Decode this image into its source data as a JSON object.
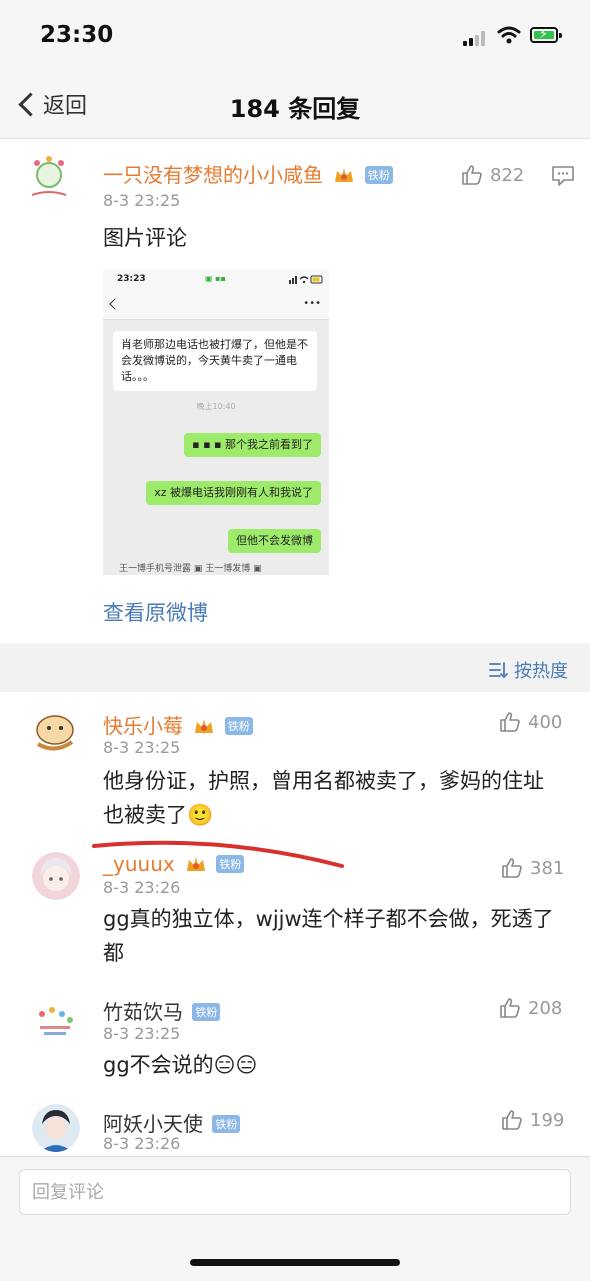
{
  "status_bar": {
    "time": "23:30"
  },
  "nav": {
    "back_label": "返回",
    "title": "184 条回复"
  },
  "main_comment": {
    "username": "一只没有梦想的小小咸鱼",
    "badge": "铁粉",
    "time": "8-3 23:25",
    "likes": "822",
    "text": "图片评论",
    "view_original": "查看原微博",
    "screenshot": {
      "time": "23:23",
      "message": "肖老师那边电话也被打爆了，但他是不会发微博说的，今天黄牛卖了一通电话。。。",
      "timestamp": "晚上10:40",
      "sent": [
        "▪ ▪ ▪ 那个我之前看到了",
        "xz 被爆电话我刚刚有人和我说了",
        "但他不会发微博"
      ],
      "cut_text": "王一博手机号泄露 ▣   王一博发博 ▣"
    }
  },
  "sort": {
    "label": "按热度"
  },
  "replies": [
    {
      "username": "快乐小莓",
      "badge": "铁粉",
      "has_crown": true,
      "time": "8-3 23:25",
      "likes": "400",
      "text": "他身份证，护照，曾用名都被卖了，爹妈的住址也被卖了🙂"
    },
    {
      "username": "_yuuux",
      "badge": "铁粉",
      "has_crown": true,
      "time": "8-3 23:26",
      "likes": "381",
      "text": "gg真的独立体，wjjw连个样子都不会做，死透了都"
    },
    {
      "username": "竹茹饮马",
      "badge": "铁粉",
      "has_crown": false,
      "time": "8-3 23:25",
      "likes": "208",
      "text": "gg不会说的😑😑"
    },
    {
      "username": "阿妖小天使",
      "badge": "铁粉",
      "has_crown": false,
      "time": "8-3 23:26",
      "likes": "199",
      "text": ""
    }
  ],
  "footer": {
    "reply_placeholder": "回复评论"
  },
  "colors": {
    "username": "#e87a2f",
    "link": "#4a7bb8",
    "badge": "#8cb8e8",
    "annotation_line": "#d9302c"
  }
}
